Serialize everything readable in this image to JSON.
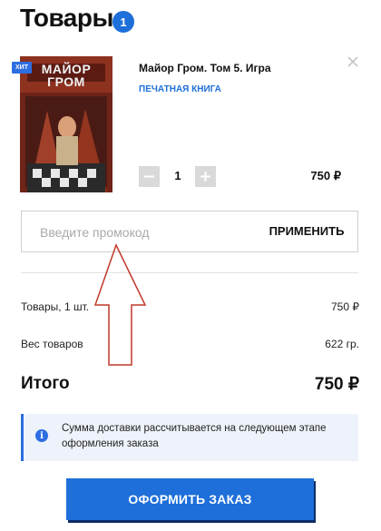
{
  "header": {
    "title": "Товары",
    "count": "1"
  },
  "item": {
    "badge": "ХИТ",
    "cover_title": "МАЙОР ГРОМ",
    "title": "Майор Гром. Том 5. Игра",
    "type": "ПЕЧАТНАЯ КНИГА",
    "remove_icon": "close-icon",
    "quantity": "1",
    "price": "750 ₽"
  },
  "promo": {
    "placeholder": "Введите промокод",
    "apply_label": "ПРИМЕНИТЬ"
  },
  "summary": {
    "goods_label": "Товары, 1 шт.",
    "goods_value": "750 ₽",
    "weight_label": "Вес товаров",
    "weight_value": "622 гр.",
    "total_label": "Итого",
    "total_value": "750 ₽"
  },
  "info": {
    "icon": "info-icon",
    "text": "Сумма доставки рассчитывается на следующем этапе оформления заказа"
  },
  "order_button": "ОФОРМИТЬ ЗАКАЗ",
  "colors": {
    "accent": "#1e6fd9",
    "info_bg": "#eef3fb",
    "annotation_arrow": "#c0392b"
  }
}
